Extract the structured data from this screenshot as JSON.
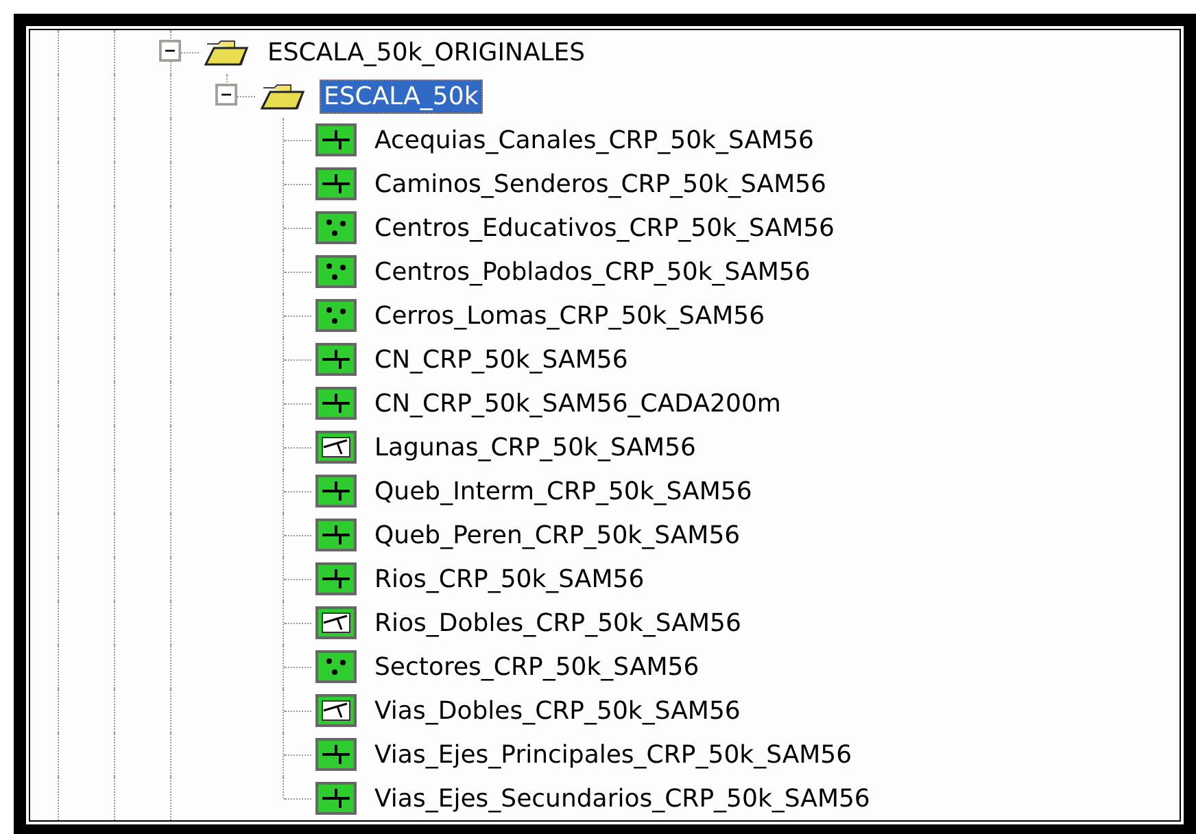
{
  "tree": [
    {
      "label": "ESCALA_50k_ORIGINALES",
      "kind": "folder",
      "expanded": true,
      "selected": false,
      "children": [
        {
          "label": "ESCALA_50k",
          "kind": "folder",
          "expanded": true,
          "selected": true,
          "children": [
            {
              "label": "Acequias_Canales_CRP_50k_SAM56",
              "kind": "line",
              "selected": false
            },
            {
              "label": "Caminos_Senderos_CRP_50k_SAM56",
              "kind": "line",
              "selected": false
            },
            {
              "label": "Centros_Educativos_CRP_50k_SAM56",
              "kind": "point",
              "selected": false
            },
            {
              "label": "Centros_Poblados_CRP_50k_SAM56",
              "kind": "point",
              "selected": false
            },
            {
              "label": "Cerros_Lomas_CRP_50k_SAM56",
              "kind": "point",
              "selected": false
            },
            {
              "label": "CN_CRP_50k_SAM56",
              "kind": "line",
              "selected": false
            },
            {
              "label": "CN_CRP_50k_SAM56_CADA200m",
              "kind": "line",
              "selected": false
            },
            {
              "label": "Lagunas_CRP_50k_SAM56",
              "kind": "polygon",
              "selected": false
            },
            {
              "label": "Queb_Interm_CRP_50k_SAM56",
              "kind": "line",
              "selected": false
            },
            {
              "label": "Queb_Peren_CRP_50k_SAM56",
              "kind": "line",
              "selected": false
            },
            {
              "label": "Rios_CRP_50k_SAM56",
              "kind": "line",
              "selected": false
            },
            {
              "label": "Rios_Dobles_CRP_50k_SAM56",
              "kind": "polygon",
              "selected": false
            },
            {
              "label": "Sectores_CRP_50k_SAM56",
              "kind": "point",
              "selected": false
            },
            {
              "label": "Vias_Dobles_CRP_50k_SAM56",
              "kind": "polygon",
              "selected": false
            },
            {
              "label": "Vias_Ejes_Principales_CRP_50k_SAM56",
              "kind": "line",
              "selected": false
            },
            {
              "label": "Vias_Ejes_Secundarios_CRP_50k_SAM56",
              "kind": "line",
              "selected": false
            }
          ]
        }
      ]
    }
  ]
}
